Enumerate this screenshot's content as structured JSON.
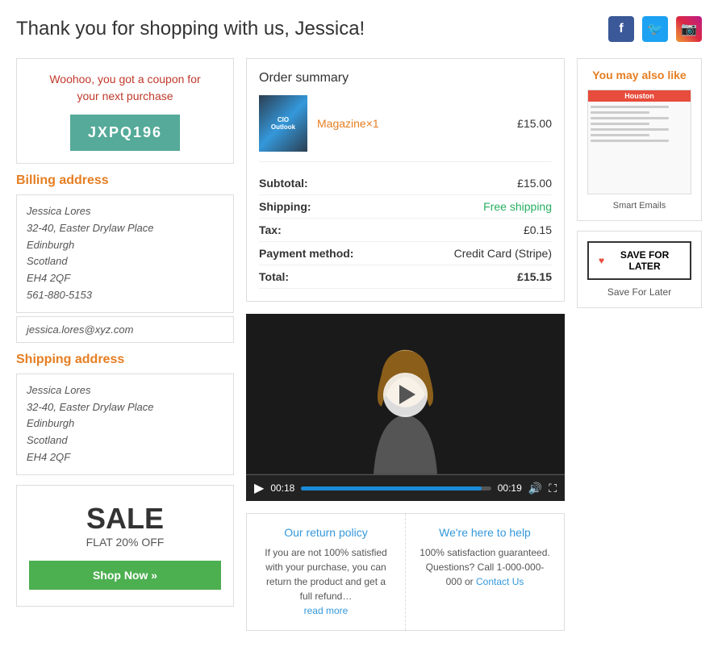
{
  "header": {
    "title": "Thank you for shopping with us, Jessica!",
    "social": {
      "facebook": "f",
      "twitter": "t",
      "instagram": "ig"
    }
  },
  "coupon": {
    "text1": "Woohoo, you got a coupon for",
    "text2": "your next purchase",
    "code": "JXPQ196"
  },
  "billing": {
    "title": "Billing address",
    "name": "Jessica Lores",
    "address1": "32-40, Easter Drylaw Place",
    "city": "Edinburgh",
    "region": "Scotland",
    "postcode": "EH4 2QF",
    "phone": "561-880-5153",
    "email": "jessica.lores@xyz.com"
  },
  "shipping": {
    "title": "Shipping address",
    "name": "Jessica Lores",
    "address1": "32-40, Easter Drylaw Place",
    "city": "Edinburgh",
    "region": "Scotland",
    "postcode": "EH4 2QF"
  },
  "sale": {
    "title": "SALE",
    "subtitle": "FLAT 20% OFF",
    "button": "Shop Now »"
  },
  "order": {
    "title": "Order summary",
    "product": {
      "name": "Magazine",
      "quantity": "×1",
      "price": "£15.00",
      "img_label": "CIO Outlook"
    },
    "subtotal_label": "Subtotal:",
    "subtotal_value": "£15.00",
    "shipping_label": "Shipping:",
    "shipping_value": "Free shipping",
    "tax_label": "Tax:",
    "tax_value": "£0.15",
    "payment_label": "Payment method:",
    "payment_value": "Credit Card (Stripe)",
    "total_label": "Total:",
    "total_value": "£15.15"
  },
  "video": {
    "time_current": "00:18",
    "time_total": "00:19",
    "progress_percent": 95
  },
  "return_policy": {
    "title": "Our return policy",
    "text": "If you are not 100% satisfied with your purchase, you can return the product and get a full refund…",
    "read_more": "read more"
  },
  "help": {
    "title": "We're here to help",
    "text": "100% satisfaction guaranteed. Questions? Call 1-000-000-000 or",
    "link_text": "Contact Us"
  },
  "also_like": {
    "title": "You may also like",
    "product_label": "Smart Emails",
    "product_header": "Houston"
  },
  "save_later": {
    "button_label": "SAVE FOR LATER",
    "label": "Save For Later"
  }
}
